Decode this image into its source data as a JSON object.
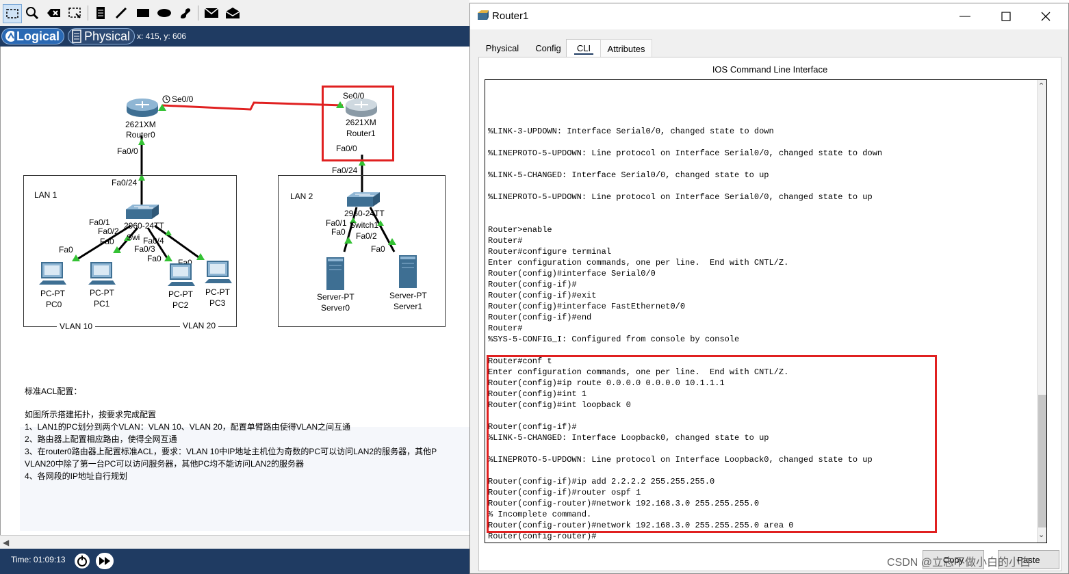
{
  "app": {
    "mode_logical": "Logical",
    "mode_physical": "Physical",
    "coords": "x: 415, y: 606",
    "time": "Time: 01:09:13"
  },
  "toolbar_icons": [
    "select-icon",
    "inspect-icon",
    "delete-icon",
    "resize-icon",
    "note-icon",
    "draw-line-icon",
    "rectangle-icon",
    "ellipse-icon",
    "freeform-icon",
    "simple-pdu-icon",
    "complex-pdu-icon"
  ],
  "topology": {
    "router0": {
      "model": "2621XM",
      "name": "Router0",
      "port_serial": "Se0/0",
      "port_fa": "Fa0/0"
    },
    "router1": {
      "model": "2621XM",
      "name": "Router1",
      "port_serial": "Se0/0",
      "port_fa": "Fa0/0"
    },
    "lan1": {
      "label": "LAN 1",
      "switch_model": "2960-24TT",
      "switch_name": "Swi",
      "uplink": "Fa0/24",
      "ports": [
        "Fa0/1",
        "Fa0/2",
        "Fa0/4",
        "Fa0/3",
        "Fa0",
        "Fa0",
        "Fa0",
        "Fa0",
        "Fa0"
      ],
      "vlan_a": "VLAN 10",
      "vlan_b": "VLAN 20",
      "pcs": [
        {
          "type": "PC-PT",
          "name": "PC0"
        },
        {
          "type": "PC-PT",
          "name": "PC1"
        },
        {
          "type": "PC-PT",
          "name": "PC2"
        },
        {
          "type": "PC-PT",
          "name": "PC3"
        }
      ]
    },
    "lan2": {
      "label": "LAN 2",
      "switch_model": "2960-24TT",
      "switch_name": "Switch1",
      "uplink": "Fa0/24",
      "ports": [
        "Fa0/1",
        "Fa0/2",
        "Fa0",
        "Fa0"
      ],
      "servers": [
        {
          "type": "Server-PT",
          "name": "Server0"
        },
        {
          "type": "Server-PT",
          "name": "Server1"
        }
      ]
    }
  },
  "notes": [
    "标准ACL配置：",
    "",
    "如图所示搭建拓扑，按要求完成配置",
    "1、LAN1的PC划分到两个VLAN：VLAN 10、VLAN 20，配置单臂路由使得VLAN之间互通",
    "2、路由器上配置相应路由，使得全网互通",
    "3、在router0路由器上配置标准ACL，要求：VLAN 10中IP地址主机位为奇数的PC可以访问LAN2的服务器，其他P",
    "VLAN20中除了第一台PC可以访问服务器，其他PC均不能访问LAN2的服务器",
    "4、各网段的IP地址自行规划"
  ],
  "window": {
    "title": "Router1",
    "tabs": [
      "Physical",
      "Config",
      "CLI",
      "Attributes"
    ],
    "cli_title": "IOS Command Line Interface",
    "copy_label": "Copy",
    "paste_label": "Paste",
    "cli_lines": [
      "%LINK-3-UPDOWN: Interface Serial0/0, changed state to down",
      "",
      "%LINEPROTO-5-UPDOWN: Line protocol on Interface Serial0/0, changed state to down",
      "",
      "%LINK-5-CHANGED: Interface Serial0/0, changed state to up",
      "",
      "%LINEPROTO-5-UPDOWN: Line protocol on Interface Serial0/0, changed state to up",
      "",
      "",
      "Router>enable",
      "Router#",
      "Router#configure terminal",
      "Enter configuration commands, one per line.  End with CNTL/Z.",
      "Router(config)#interface Serial0/0",
      "Router(config-if)#",
      "Router(config-if)#exit",
      "Router(config)#interface FastEthernet0/0",
      "Router(config-if)#end",
      "Router#",
      "%SYS-5-CONFIG_I: Configured from console by console",
      "",
      "Router#conf t",
      "Enter configuration commands, one per line.  End with CNTL/Z.",
      "Router(config)#ip route 0.0.0.0 0.0.0.0 10.1.1.1",
      "Router(config)#int 1",
      "Router(config)#int loopback 0",
      "",
      "Router(config-if)#",
      "%LINK-5-CHANGED: Interface Loopback0, changed state to up",
      "",
      "%LINEPROTO-5-UPDOWN: Line protocol on Interface Loopback0, changed state to up",
      "",
      "Router(config-if)#ip add 2.2.2.2 255.255.255.0",
      "Router(config-if)#router ospf 1",
      "Router(config-router)#network 192.168.3.0 255.255.255.0",
      "% Incomplete command.",
      "Router(config-router)#network 192.168.3.0 255.255.255.0 area 0",
      "Router(config-router)#"
    ]
  },
  "watermark": "CSDN @立志不做小白的小白",
  "colors": {
    "dark_blue": "#1f3b62",
    "highlight_red": "#e02020",
    "link_green": "#34c234",
    "serial_red": "#e02020"
  }
}
